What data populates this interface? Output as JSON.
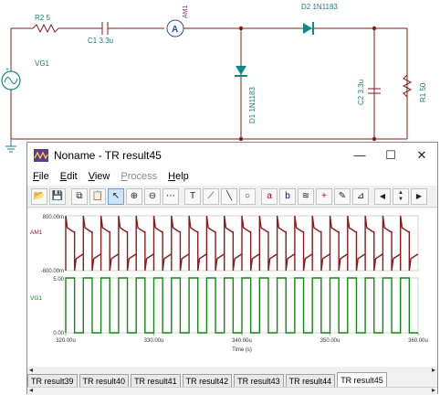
{
  "schematic": {
    "r2_label": "R2 5",
    "c1_label": "C1 3.3u",
    "ammeter_symbol": "A",
    "ammeter_label": "AM1",
    "d2_label": "D2 1N1183",
    "vg1_label": "VG1",
    "d1_label": "D1 1N1183",
    "c2_label": "C2 3.3u",
    "r1_label": "R1 50"
  },
  "window": {
    "title": "Noname - TR result45",
    "minimize": "—",
    "maximize": "☐",
    "close": "✕"
  },
  "menu": [
    {
      "ul": "F",
      "rest": "ile"
    },
    {
      "ul": "E",
      "rest": "dit"
    },
    {
      "ul": "V",
      "rest": "iew"
    },
    {
      "ul": "P",
      "rest": "rocess"
    },
    {
      "ul": "H",
      "rest": "elp"
    }
  ],
  "toolbar": {
    "open": "📂",
    "save": "💾",
    "copy": "⧉",
    "paste": "📋",
    "pointer": "↖",
    "zoom_in": "⊕",
    "zoom_out": "⊖",
    "grid": "⋯",
    "text": "T",
    "measure": "⟋",
    "line": "╲",
    "circle": "○",
    "cursor_a": "a",
    "cursor_b": "b",
    "curves": "≋",
    "marker": "+",
    "pen": "✎",
    "angle": "⊿",
    "prev": "◀",
    "up": "▲",
    "down": "▼",
    "next": "▶"
  },
  "chart_data": {
    "type": "line",
    "xlabel": "Time (s)",
    "x_ticks": [
      "320.00u",
      "330.00u",
      "340.00u",
      "350.00u",
      "360.00u"
    ],
    "xlim": [
      320,
      360
    ],
    "panels": [
      {
        "name": "AM1",
        "color": "#8b1a1a",
        "y_ticks": [
          "800.00m",
          "-800.00m"
        ],
        "ylim": [
          -800,
          800
        ],
        "period_us": 2.0,
        "high_peak": 800,
        "low_peak": -800,
        "settle_high": 330,
        "settle_low": -330
      },
      {
        "name": "VG1",
        "color": "#118811",
        "y_ticks": [
          "5.00",
          "0.00"
        ],
        "ylim": [
          0,
          5
        ],
        "period_us": 2.0,
        "high": 5,
        "low": 0
      }
    ]
  },
  "tabs": [
    "TR result39",
    "TR result40",
    "TR result41",
    "TR result42",
    "TR result43",
    "TR result44",
    "TR result45"
  ],
  "active_tab": "TR result45"
}
